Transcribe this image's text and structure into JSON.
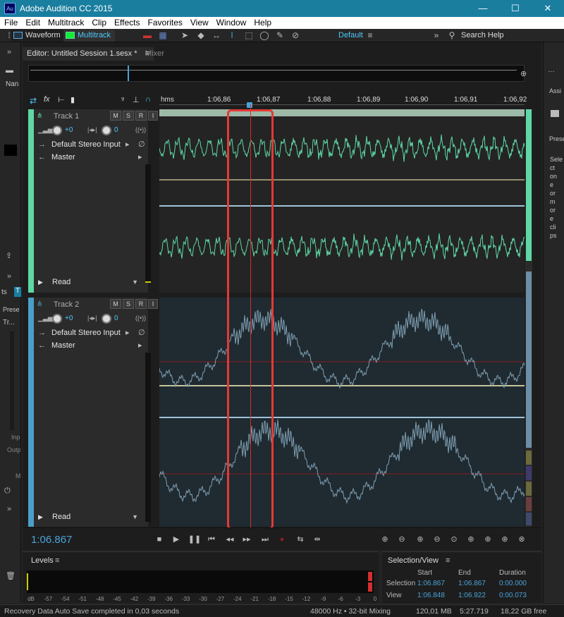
{
  "app": {
    "title": "Adobe Audition CC 2015",
    "icon": "Au"
  },
  "window_controls": {
    "minimize": "—",
    "maximize": "☐",
    "close": "✕"
  },
  "menu": [
    "File",
    "Edit",
    "Multitrack",
    "Clip",
    "Effects",
    "Favorites",
    "View",
    "Window",
    "Help"
  ],
  "toolbar": {
    "waveform": "Waveform",
    "multitrack": "Multitrack",
    "workspace": "Default",
    "search": "Search Help"
  },
  "left_panels": {
    "name_label": "Nan",
    "tab_a": "ts",
    "tab_b": "T",
    "preset": "Prese",
    "track": "Tr...",
    "input": "Inp",
    "output": "Outp",
    "mark": "M"
  },
  "right_panel": {
    "assign": "Assi",
    "preset": "Prese",
    "hint": [
      "Sele",
      "ct",
      "on",
      "e",
      "or",
      "m",
      "or",
      "e",
      "cli",
      "ps"
    ]
  },
  "editor": {
    "tab_editor": "Editor: Untitled Session 1.sesx *",
    "tab_mixer": "Mixer",
    "ruler": {
      "unit": "hms",
      "ticks": [
        "1:06,86",
        "1:06,87",
        "1:06,88",
        "1:06,89",
        "1:06,90",
        "1:06,91",
        "1:06,92"
      ]
    },
    "tracks": [
      {
        "name": "Track 1",
        "m": "M",
        "s": "S",
        "r": "R",
        "i": "I",
        "volume": "+0",
        "pan": "0",
        "input": "Default Stereo Input",
        "output": "Master",
        "automation": "Read"
      },
      {
        "name": "Track 2",
        "m": "M",
        "s": "S",
        "r": "R",
        "i": "I",
        "volume": "+0",
        "pan": "0",
        "input": "Default Stereo Input",
        "output": "Master",
        "automation": "Read"
      }
    ],
    "timecode": "1:06.867"
  },
  "levels": {
    "title": "Levels",
    "scale": [
      "dB",
      "-57",
      "-54",
      "-51",
      "-48",
      "-45",
      "-42",
      "-39",
      "-36",
      "-33",
      "-30",
      "-27",
      "-24",
      "-21",
      "-18",
      "-15",
      "-12",
      "-9",
      "-6",
      "-3",
      "0"
    ]
  },
  "selection_view": {
    "title": "Selection/View",
    "headers": [
      "Start",
      "End",
      "Duration"
    ],
    "rows": [
      {
        "label": "Selection",
        "start": "1:06.867",
        "end": "1:06.867",
        "duration": "0:00.000"
      },
      {
        "label": "View",
        "start": "1:06.848",
        "end": "1:06.922",
        "duration": "0:00.073"
      }
    ]
  },
  "status": {
    "message": "Recovery Data Auto Save completed in 0,03 seconds",
    "format": "48000 Hz • 32-bit Mixing",
    "memory": "120,01 MB",
    "duration": "5:27.719",
    "disk": "18,22 GB free"
  },
  "colors": {
    "accent": "#1a7e9f",
    "track1": "#5fd8a6",
    "track2": "#4a9fc9",
    "playhead": "#d32f2f",
    "highlight": "#e53935",
    "timecode": "#4aa3d8"
  }
}
